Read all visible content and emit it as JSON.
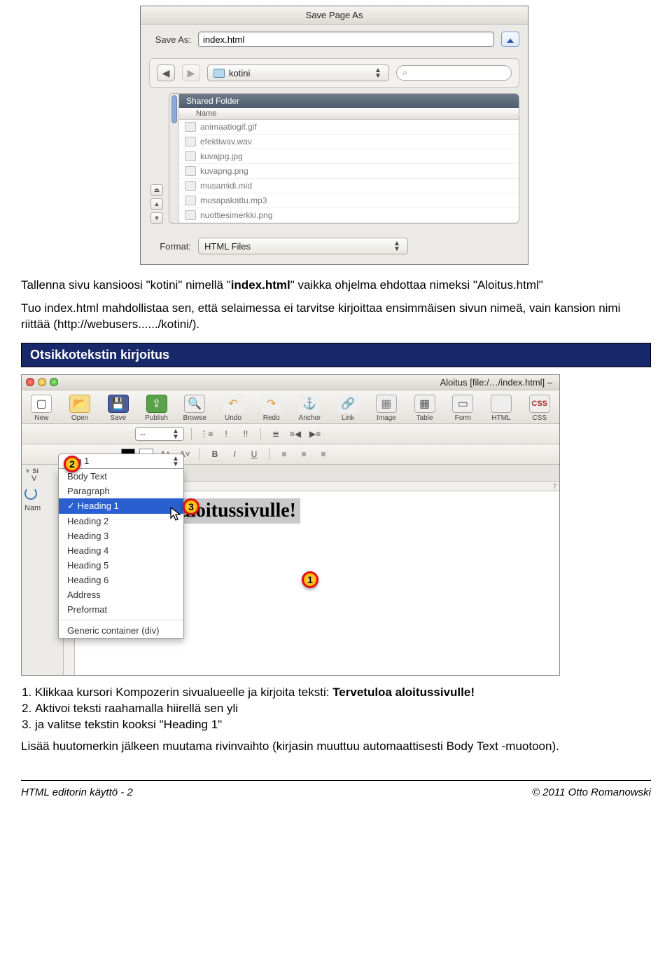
{
  "save_dialog": {
    "title": "Save Page As",
    "save_as_label": "Save As:",
    "filename": "index.html",
    "folder": "kotini",
    "search_glyph": "⌕",
    "shared_header": "Shared Folder",
    "name_col": "Name",
    "files": [
      "animaatiogif.gif",
      "efektiwav.wav",
      "kuvajpg.jpg",
      "kuvapng.png",
      "musamidi.mid",
      "musapakattu.mp3",
      "nuottiesimerkki.png"
    ],
    "format_label": "Format:",
    "format_value": "HTML Files",
    "eject_glyph": "⏏"
  },
  "paragraph1_parts": {
    "p1a": "Tallenna sivu kansioosi \"kotini\" nimellä \"",
    "p1b": "index.html",
    "p1c": "\" vaikka ohjelma ehdottaa nimeksi \"Aloitus.html\"",
    "p2": "Tuo index.html mahdollistaa sen, että selaimessa ei tarvitse kirjoittaa ensimmäisen sivun nimeä, vain kansion nimi riittää (http://webusers....../kotini/)."
  },
  "section1": "Otsikkotekstin kirjoitus",
  "kompozer": {
    "window_title": "Aloitus [file:/…/index.html] –",
    "toolbar": [
      "New",
      "Open",
      "Save",
      "Publish",
      "Browse",
      "Undo",
      "Redo",
      "Anchor",
      "Link",
      "Image",
      "Table",
      "Form",
      "HTML",
      "CSS"
    ],
    "style_dd_visible": "ng 1",
    "dd2": "--",
    "fontsize_a": "A˄",
    "fontsize_b": "A˅",
    "bold": "B",
    "italic": "I",
    "underline": "U",
    "tab_label": "Aloitus",
    "ruler_mark": "7",
    "vruler": "32px",
    "headline": "Tervetuloa aloitussivulle!",
    "sidebar_si": "Si",
    "sidebar_v": "V",
    "sidebar_nam": "Nam",
    "dropdown": {
      "top": "ng 1",
      "items": [
        "Body Text",
        "Paragraph",
        "Heading 1",
        "Heading 2",
        "Heading 3",
        "Heading 4",
        "Heading 5",
        "Heading 6",
        "Address",
        "Preformat"
      ],
      "selected_index": 2,
      "generic": "Generic container (div)"
    },
    "markers": {
      "m1": "1",
      "m2": "2",
      "m3": "3"
    }
  },
  "instructions": {
    "i1a": "Klikkaa kursori Kompozerin sivualueelle ja kirjoita teksti: ",
    "i1b": "Tervetuloa aloitussivulle!",
    "i2": "Aktivoi teksti raahamalla hiirellä sen yli",
    "i3": "ja valitse tekstin kooksi \"Heading 1\""
  },
  "paragraph2": "Lisää huutomerkin jälkeen muutama rivinvaihto (kirjasin muuttuu automaattisesti Body Text -muotoon).",
  "footer": {
    "left": "HTML editorin käyttö - 2",
    "right": "© 2011 Otto Romanowski"
  }
}
